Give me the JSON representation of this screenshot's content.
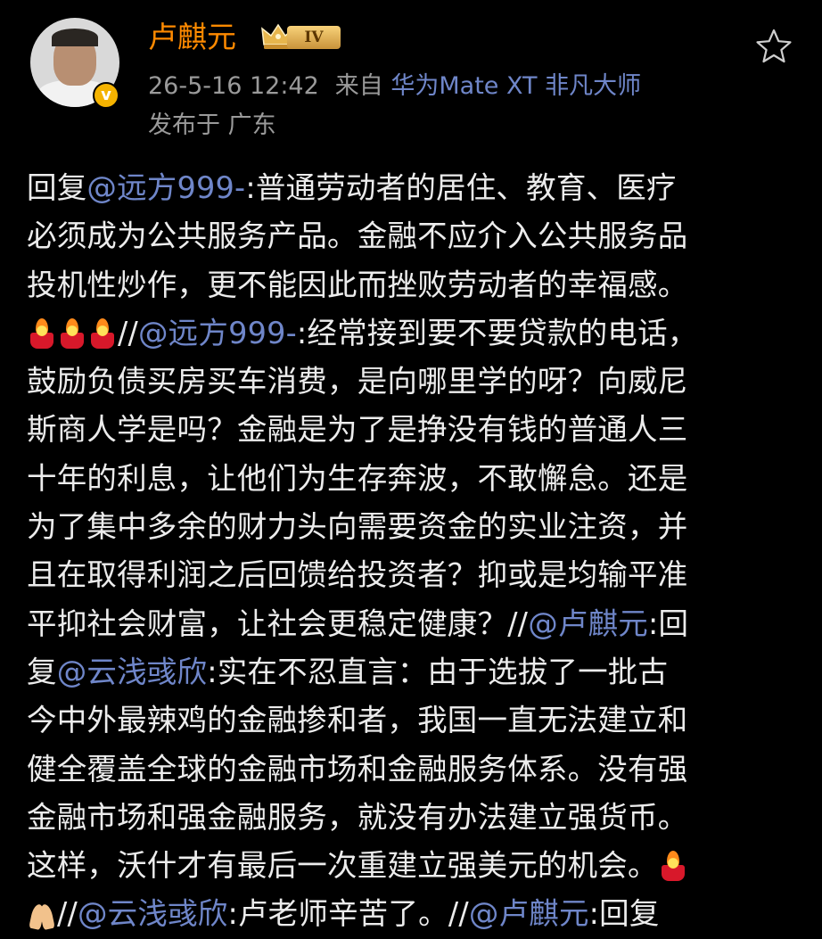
{
  "post": {
    "author": "卢麒元",
    "level_badge": "IV",
    "verified_mark": "v",
    "timestamp": "26-5-16 12:42",
    "source_prefix": "来自",
    "source_device": "华为Mate XT 非凡大师",
    "location": "发布于 广东",
    "icons": {
      "favorite": "star-outline-icon",
      "level": "crown-level-badge-icon",
      "verified": "verified-v-badge-icon"
    },
    "body_lines": [
      [
        {
          "t": "回复"
        },
        {
          "t": "@远方999-",
          "at": true
        },
        {
          "t": ":普通劳动者的居住、教育、医疗"
        }
      ],
      [
        {
          "t": "必须成为公共服务产品。金融不应介入公共服务品"
        }
      ],
      [
        {
          "t": "投机性炒作，更不能因此而挫败劳动者的幸福感。"
        }
      ],
      [
        {
          "e": "fire"
        },
        {
          "e": "fire"
        },
        {
          "e": "fire"
        },
        {
          "t": "//"
        },
        {
          "t": "@远方999-",
          "at": true
        },
        {
          "t": ":经常接到要不要贷款的电话，"
        }
      ],
      [
        {
          "t": "鼓励负债买房买车消费，是向哪里学的呀？向威尼"
        }
      ],
      [
        {
          "t": "斯商人学是吗？金融是为了是挣没有钱的普通人三"
        }
      ],
      [
        {
          "t": "十年的利息，让他们为生存奔波，不敢懈怠。还是"
        }
      ],
      [
        {
          "t": "为了集中多余的财力头向需要资金的实业注资，并"
        }
      ],
      [
        {
          "t": "且在取得利润之后回馈给投资者？抑或是均输平准"
        }
      ],
      [
        {
          "t": "平抑社会财富，让社会更稳定健康？//"
        },
        {
          "t": "@卢麒元",
          "at": true
        },
        {
          "t": ":回"
        }
      ],
      [
        {
          "t": "复"
        },
        {
          "t": "@云浅彧欣",
          "at": true
        },
        {
          "t": ":实在不忍直言：由于选拔了一批古"
        }
      ],
      [
        {
          "t": "今中外最辣鸡的金融掺和者，我国一直无法建立和"
        }
      ],
      [
        {
          "t": "健全覆盖全球的金融市场和金融服务体系。没有强"
        }
      ],
      [
        {
          "t": "金融市场和强金融服务，就没有办法建立强货币。"
        }
      ],
      [
        {
          "t": "这样，沃什才有最后一次重建立强美元的机会。"
        },
        {
          "e": "fire"
        }
      ],
      [
        {
          "e": "pray"
        },
        {
          "t": "//"
        },
        {
          "t": "@云浅彧欣",
          "at": true
        },
        {
          "t": ":卢老师辛苦了。//"
        },
        {
          "t": "@卢麒元",
          "at": true
        },
        {
          "t": ":回复"
        }
      ]
    ]
  }
}
